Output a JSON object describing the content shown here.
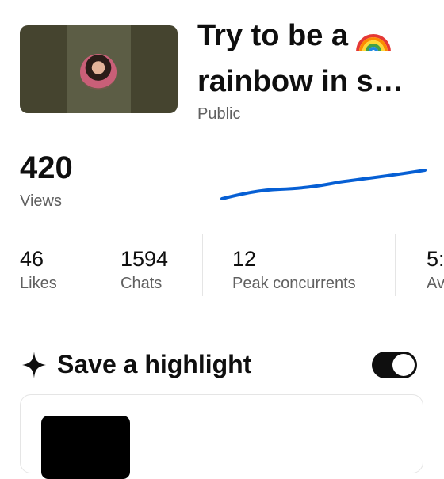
{
  "video": {
    "title_line1": "Try to be a",
    "title_line2": "rainbow in s…",
    "title_emoji_icon": "rainbow-icon",
    "visibility": "Public"
  },
  "views": {
    "value": "420",
    "label": "Views"
  },
  "stats": [
    {
      "value": "46",
      "label": "Likes"
    },
    {
      "value": "1594",
      "label": "Chats"
    },
    {
      "value": "12",
      "label": "Peak concurrents"
    },
    {
      "value": "5:",
      "label": "Av"
    }
  ],
  "highlight": {
    "icon": "sparkle-icon",
    "label": "Save a highlight",
    "toggle_on": true
  },
  "colors": {
    "sparkline": "#065fd4",
    "secondary_text": "#606060",
    "toggle_on": "#0f0f0f"
  }
}
